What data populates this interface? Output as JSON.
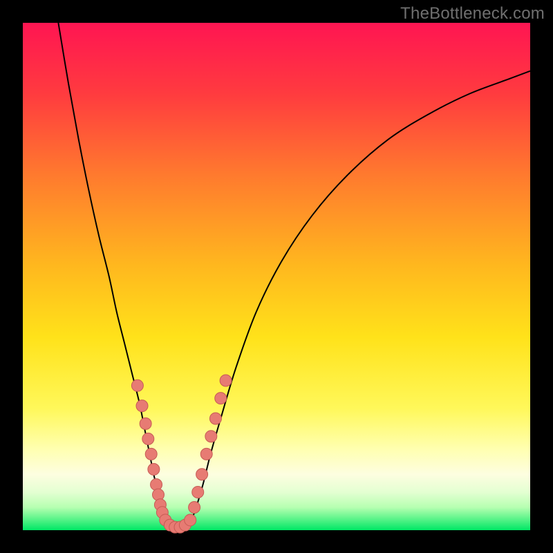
{
  "watermark": "TheBottleneck.com",
  "colors": {
    "frame_black": "#000000",
    "watermark_text": "#6f6f6f",
    "curve_stroke": "#000000",
    "dot_fill": "#e77b73",
    "dot_stroke": "#c65b54",
    "gradient_stops": [
      {
        "pos": 0.0,
        "color": "#ff1552"
      },
      {
        "pos": 0.14,
        "color": "#ff3b3f"
      },
      {
        "pos": 0.3,
        "color": "#ff7a2e"
      },
      {
        "pos": 0.48,
        "color": "#ffb81e"
      },
      {
        "pos": 0.62,
        "color": "#ffe21a"
      },
      {
        "pos": 0.76,
        "color": "#fff85a"
      },
      {
        "pos": 0.84,
        "color": "#ffffb0"
      },
      {
        "pos": 0.89,
        "color": "#fdfee0"
      },
      {
        "pos": 0.925,
        "color": "#e4ffd2"
      },
      {
        "pos": 0.955,
        "color": "#b6ffb1"
      },
      {
        "pos": 0.975,
        "color": "#66f58e"
      },
      {
        "pos": 1.0,
        "color": "#00e765"
      }
    ]
  },
  "chart_data": {
    "type": "line",
    "title": "",
    "xlabel": "",
    "ylabel": "",
    "xlim": [
      0,
      100
    ],
    "ylim": [
      0,
      100
    ],
    "series": [
      {
        "name": "left-branch",
        "x": [
          7,
          9,
          11,
          13,
          15,
          17,
          18.5,
          20,
          21.5,
          23,
          24,
          25,
          25.8,
          26.5,
          27.2,
          27.8,
          28.3
        ],
        "y": [
          100,
          88,
          77,
          67,
          58,
          50,
          43,
          37,
          31,
          25,
          20,
          15,
          11,
          8,
          5,
          3,
          1.5
        ]
      },
      {
        "name": "bottom-flat",
        "x": [
          28.3,
          29,
          29.8,
          30.6,
          31.4,
          32.2,
          33
        ],
        "y": [
          1.5,
          0.8,
          0.5,
          0.4,
          0.5,
          0.8,
          1.5
        ]
      },
      {
        "name": "right-branch",
        "x": [
          33,
          34,
          35.5,
          37,
          39,
          42,
          46,
          51,
          57,
          64,
          72,
          80,
          88,
          96,
          100
        ],
        "y": [
          1.5,
          4,
          9,
          15,
          22,
          32,
          43,
          53,
          62,
          70,
          77,
          82,
          86,
          89,
          90.5
        ]
      }
    ],
    "dots": {
      "name": "highlight-dots",
      "points": [
        {
          "x": 22.6,
          "y": 28.5
        },
        {
          "x": 23.5,
          "y": 24.5
        },
        {
          "x": 24.2,
          "y": 21.0
        },
        {
          "x": 24.7,
          "y": 18.0
        },
        {
          "x": 25.3,
          "y": 15.0
        },
        {
          "x": 25.8,
          "y": 12.0
        },
        {
          "x": 26.3,
          "y": 9.0
        },
        {
          "x": 26.7,
          "y": 7.0
        },
        {
          "x": 27.1,
          "y": 5.0
        },
        {
          "x": 27.5,
          "y": 3.5
        },
        {
          "x": 28.1,
          "y": 2.0
        },
        {
          "x": 29.0,
          "y": 1.0
        },
        {
          "x": 30.0,
          "y": 0.6
        },
        {
          "x": 31.0,
          "y": 0.6
        },
        {
          "x": 32.0,
          "y": 1.0
        },
        {
          "x": 33.0,
          "y": 2.0
        },
        {
          "x": 33.8,
          "y": 4.5
        },
        {
          "x": 34.5,
          "y": 7.5
        },
        {
          "x": 35.3,
          "y": 11.0
        },
        {
          "x": 36.2,
          "y": 15.0
        },
        {
          "x": 37.1,
          "y": 18.5
        },
        {
          "x": 38.0,
          "y": 22.0
        },
        {
          "x": 39.0,
          "y": 26.0
        },
        {
          "x": 40.0,
          "y": 29.5
        }
      ]
    }
  }
}
